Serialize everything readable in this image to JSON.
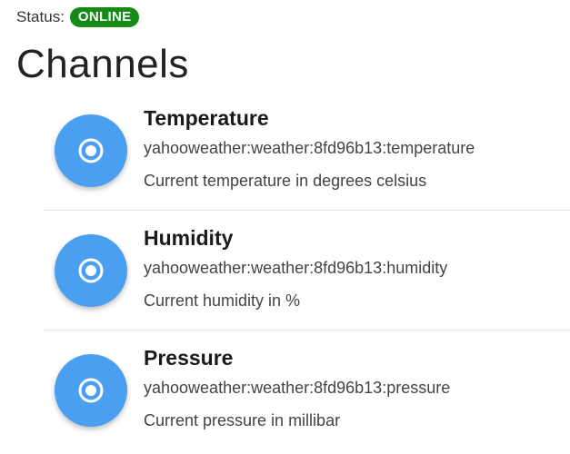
{
  "status": {
    "label": "Status:",
    "value": "ONLINE",
    "color": "#168a16"
  },
  "title": "Channels",
  "accent_color": "#4a9ff0",
  "channels": [
    {
      "label": "Temperature",
      "uid": "yahooweather:weather:8fd96b13:temperature",
      "description": "Current temperature in degrees celsius",
      "icon": "radio-button-checked-icon"
    },
    {
      "label": "Humidity",
      "uid": "yahooweather:weather:8fd96b13:humidity",
      "description": "Current humidity in %",
      "icon": "radio-button-checked-icon"
    },
    {
      "label": "Pressure",
      "uid": "yahooweather:weather:8fd96b13:pressure",
      "description": "Current pressure in millibar",
      "icon": "radio-button-checked-icon"
    }
  ]
}
